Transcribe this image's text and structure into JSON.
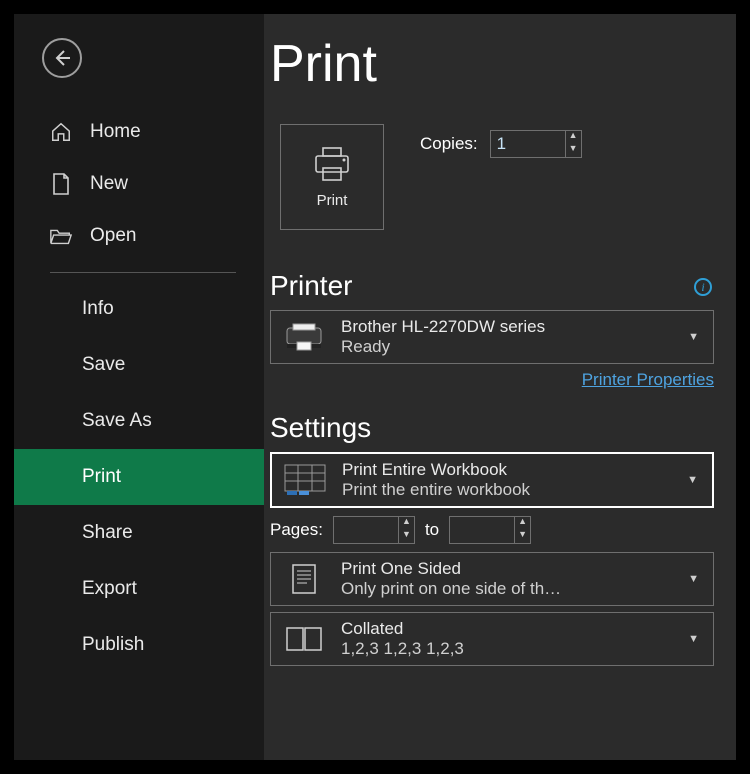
{
  "sidebar": {
    "home": "Home",
    "new": "New",
    "open": "Open",
    "info": "Info",
    "save": "Save",
    "save_as": "Save As",
    "print": "Print",
    "share": "Share",
    "export": "Export",
    "publish": "Publish"
  },
  "page": {
    "title": "Print",
    "print_button": "Print",
    "copies_label": "Copies:",
    "copies_value": "1",
    "printer_heading": "Printer",
    "printer_name": "Brother HL-2270DW series",
    "printer_status": "Ready",
    "printer_props_link": "Printer Properties",
    "settings_heading": "Settings",
    "setting_what": {
      "title": "Print Entire Workbook",
      "sub": "Print the entire workbook"
    },
    "pages_label": "Pages:",
    "pages_from": "",
    "pages_to_label": "to",
    "pages_to": "",
    "setting_sides": {
      "title": "Print One Sided",
      "sub": "Only print on one side of th…"
    },
    "setting_collate": {
      "title": "Collated",
      "sub": "1,2,3    1,2,3    1,2,3"
    }
  }
}
